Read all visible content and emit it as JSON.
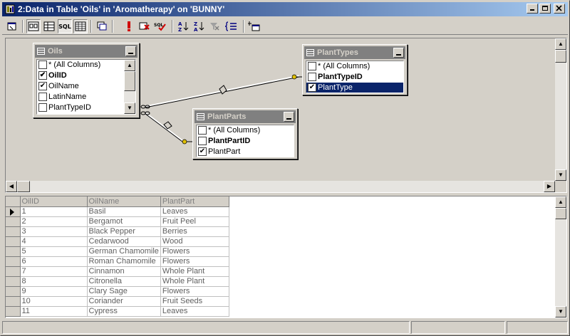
{
  "window": {
    "title": "2:Data in Table 'Oils' in 'Aromatherapy' on 'BUNNY'"
  },
  "toolbar": {
    "buttons": [
      "properties-icon",
      "show-diagram-icon",
      "show-grid-icon",
      "show-sql-icon",
      "show-results-icon",
      "change-type-icon",
      "run-icon",
      "verify-sql-icon",
      "sql-check-icon",
      "sort-ascending-icon",
      "sort-descending-icon",
      "remove-filter-icon",
      "group-by-icon",
      "add-table-icon"
    ],
    "sql_label": "SQL"
  },
  "diagram": {
    "tables": [
      {
        "name": "Oils",
        "columns": [
          {
            "label": "* (All Columns)",
            "checked": false,
            "key": false
          },
          {
            "label": "OilID",
            "checked": true,
            "key": true
          },
          {
            "label": "OilName",
            "checked": true,
            "key": false
          },
          {
            "label": "LatinName",
            "checked": false,
            "key": false
          },
          {
            "label": "PlantTypeID",
            "checked": false,
            "key": false
          }
        ]
      },
      {
        "name": "PlantTypes",
        "columns": [
          {
            "label": "* (All Columns)",
            "checked": false,
            "key": false
          },
          {
            "label": "PlantTypeID",
            "checked": false,
            "key": true
          },
          {
            "label": "PlantType",
            "checked": true,
            "key": false,
            "selected": true
          }
        ]
      },
      {
        "name": "PlantParts",
        "columns": [
          {
            "label": "* (All Columns)",
            "checked": false,
            "key": false
          },
          {
            "label": "PlantPartID",
            "checked": false,
            "key": true
          },
          {
            "label": "PlantPart",
            "checked": true,
            "key": false
          }
        ]
      }
    ]
  },
  "results": {
    "columns": [
      "OilID",
      "OilName",
      "PlantPart"
    ],
    "rows": [
      [
        "1",
        "Basil",
        "Leaves"
      ],
      [
        "2",
        "Bergamot",
        "Fruit Peel"
      ],
      [
        "3",
        "Black Pepper",
        "Berries"
      ],
      [
        "4",
        "Cedarwood",
        "Wood"
      ],
      [
        "5",
        "German Chamomile",
        "Flowers"
      ],
      [
        "6",
        "Roman Chamomile",
        "Flowers"
      ],
      [
        "7",
        "Cinnamon",
        "Whole Plant"
      ],
      [
        "8",
        "Citronella",
        "Whole Plant"
      ],
      [
        "9",
        "Clary Sage",
        "Flowers"
      ],
      [
        "10",
        "Coriander",
        "Fruit Seeds"
      ],
      [
        "11",
        "Cypress",
        "Leaves"
      ]
    ]
  },
  "colors": {
    "title_active_start": "#0a246a",
    "title_active_end": "#a6caf0",
    "inactive_caption": "#808080",
    "face": "#d4d0c8",
    "selection": "#0a246a"
  }
}
